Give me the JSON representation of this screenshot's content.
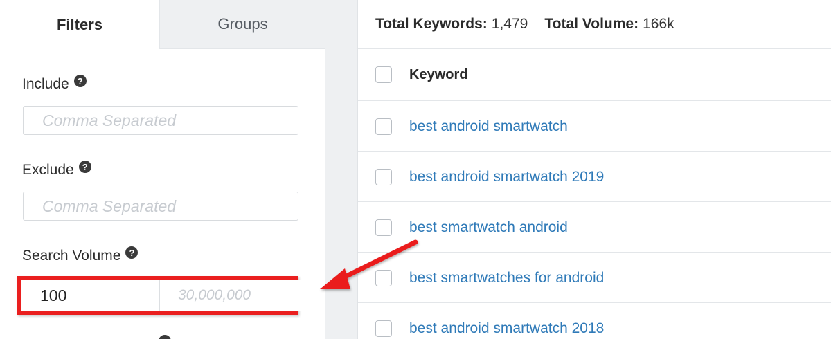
{
  "tabs": {
    "filters_label": "Filters",
    "groups_label": "Groups"
  },
  "filters": {
    "include": {
      "label": "Include",
      "placeholder": "Comma Separated",
      "value": ""
    },
    "exclude": {
      "label": "Exclude",
      "placeholder": "Comma Separated",
      "value": ""
    },
    "search_volume": {
      "label": "Search Volume",
      "min_value": "100",
      "max_placeholder": "30,000,000"
    },
    "help_glyph": "?"
  },
  "summary": {
    "total_keywords_label": "Total Keywords:",
    "total_keywords_value": "1,479",
    "total_volume_label": "Total Volume:",
    "total_volume_value": "166k"
  },
  "table": {
    "column_header": "Keyword",
    "rows": [
      "best android smartwatch",
      "best android smartwatch 2019",
      "best smartwatch android",
      "best smartwatches for android",
      "best android smartwatch 2018"
    ]
  },
  "colors": {
    "highlight_red": "#ea1f1f",
    "link_blue": "#2f7ab8",
    "panel_gray": "#eef0f2"
  }
}
